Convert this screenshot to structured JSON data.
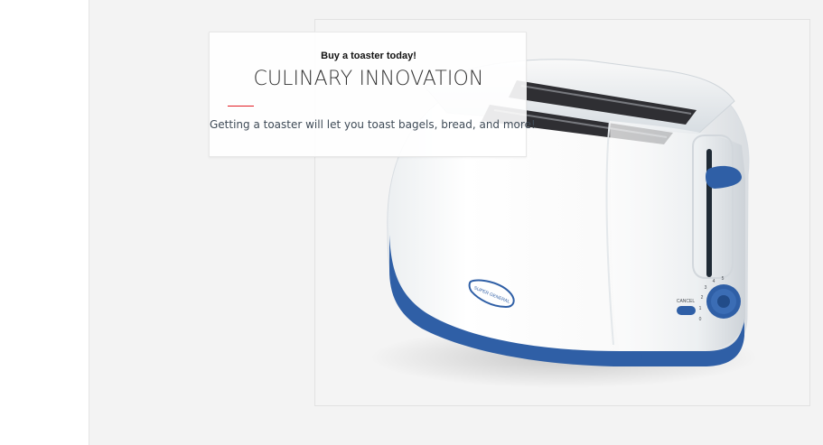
{
  "promo": {
    "eyebrow": "Buy a toaster today!",
    "headline": "CULINARY INNOVATION",
    "body": "Getting a toaster will let you toast bagels, bread, and more!"
  },
  "product": {
    "name": "toaster-image",
    "brand_badge": "SUPER GENERAL",
    "cancel_label": "CANCEL",
    "dial_numbers": [
      "0",
      "1",
      "2",
      "3",
      "4",
      "5"
    ]
  },
  "colors": {
    "page_background": "#f3f3f3",
    "card_background": "#ffffff",
    "accent_rule": "#e31b23",
    "toaster_blue": "#2f5fa6",
    "toaster_body": "#f5f5f5"
  }
}
